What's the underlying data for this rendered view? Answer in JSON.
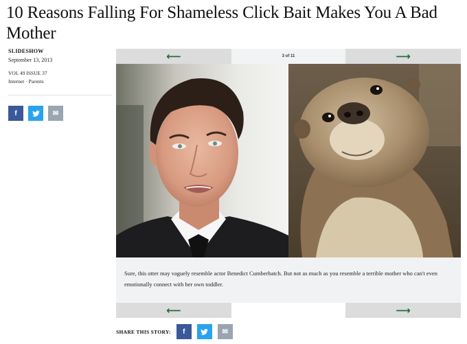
{
  "article": {
    "headline": "10 Reasons Falling For Shameless Click Bait Makes You A Bad Mother",
    "kicker": "SLIDESHOW",
    "date": "September 13, 2013",
    "volume": "VOL 49 ISSUE 37",
    "tags": "Internet · Parents"
  },
  "social": {
    "facebook_icon": "f",
    "twitter_icon": "🐦",
    "email_icon": "✉",
    "share_label": "SHARE THIS STORY:"
  },
  "slideshow": {
    "counter": "3 of 11",
    "prev_icon": "⟵",
    "next_icon": "⟶",
    "caption": "Sure, this otter may vaguely resemble actor Benedict Cumberbatch. But not as much as you resemble a terrible mother who can't even emotionally connect with her own toddler.",
    "photos": [
      {
        "subject": "man-portrait"
      },
      {
        "subject": "otter-portrait"
      }
    ]
  },
  "colors": {
    "facebook": "#3b5998",
    "twitter": "#2aa3ef",
    "email": "#9aa5b1",
    "arrow": "#1f6e3a",
    "nav_bg": "#dcdcdc",
    "caption_bg": "#f1f2f4"
  }
}
